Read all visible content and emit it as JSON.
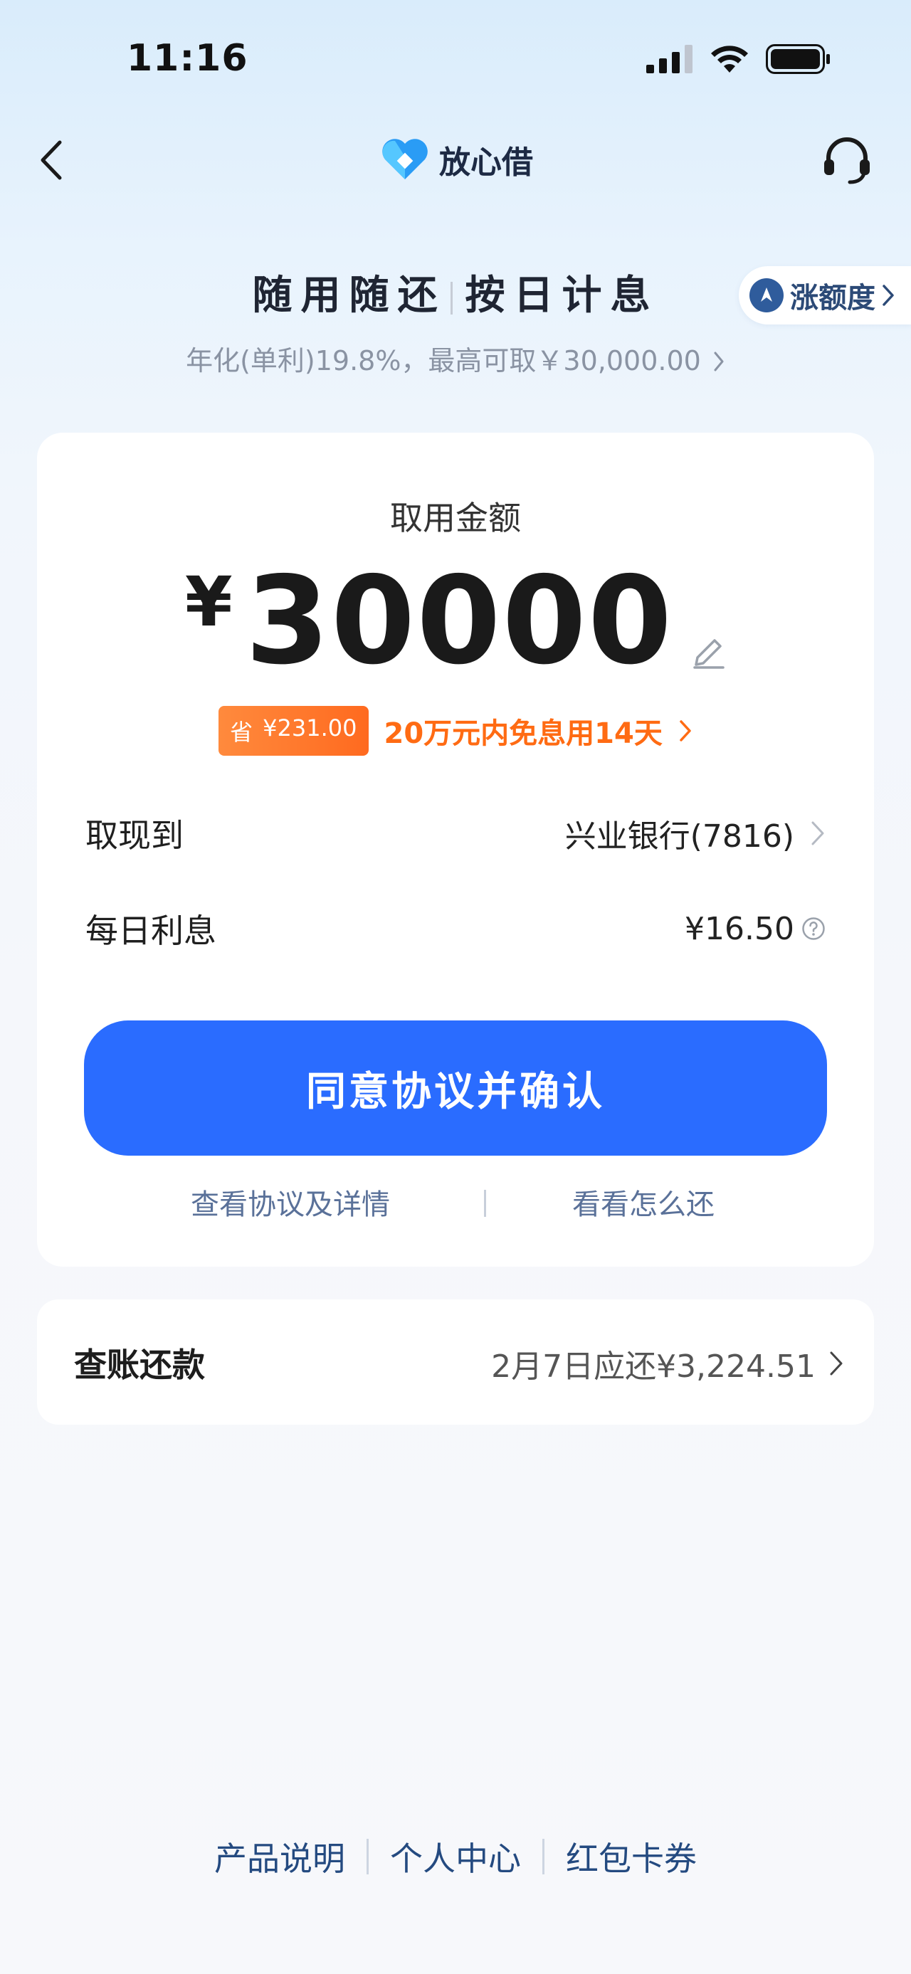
{
  "status_bar": {
    "time": "11:16"
  },
  "nav": {
    "brand": "放心借"
  },
  "hero": {
    "slogan_left": "随用随还",
    "slogan_right": "按日计息",
    "raise_label": "涨额度",
    "rate_text": "年化(单利)19.8%，最高可取￥30,000.00"
  },
  "card": {
    "title": "取用金额",
    "currency": "¥",
    "amount": "30000",
    "save_prefix": "省",
    "save_amount": "¥231.00",
    "promo": "20万元内免息用14天",
    "withdraw_label": "取现到",
    "withdraw_value": "兴业银行(7816)",
    "interest_label": "每日利息",
    "interest_value": "¥16.50",
    "confirm_label": "同意协议并确认",
    "link_agreement": "查看协议及详情",
    "link_repay": "看看怎么还"
  },
  "bill": {
    "label": "查账还款",
    "value": "2月7日应还¥3,224.51"
  },
  "footer": {
    "items": [
      "产品说明",
      "个人中心",
      "红包卡券"
    ]
  },
  "colors": {
    "primary": "#2a6cff",
    "promo": "#ff6b13",
    "nav_text": "#244a80"
  }
}
